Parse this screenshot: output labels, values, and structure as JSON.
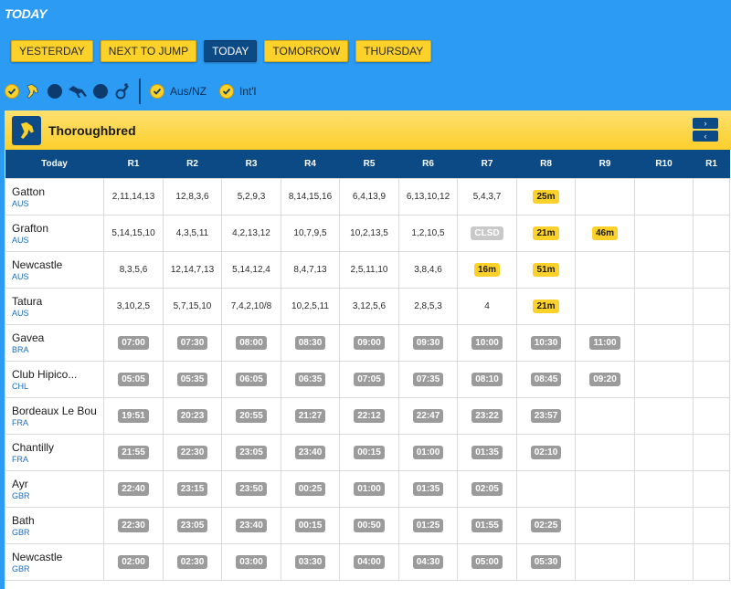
{
  "header": {
    "title": "TODAY"
  },
  "day_tabs": [
    {
      "label": "YESTERDAY",
      "active": false
    },
    {
      "label": "NEXT TO JUMP",
      "active": false
    },
    {
      "label": "TODAY",
      "active": true
    },
    {
      "label": "TOMORROW",
      "active": false
    },
    {
      "label": "THURSDAY",
      "active": false
    }
  ],
  "filters": {
    "code_icons": [
      "thoroughbred-icon",
      "harness-icon",
      "greyhound-icon"
    ],
    "regions": [
      {
        "label": "Aus/NZ",
        "checked": true
      },
      {
        "label": "Int'l",
        "checked": true
      }
    ]
  },
  "panel": {
    "title": "Thoroughbred",
    "scroll_next": "›",
    "scroll_prev": "‹"
  },
  "columns": [
    "Today",
    "R1",
    "R2",
    "R3",
    "R4",
    "R5",
    "R6",
    "R7",
    "R8",
    "R9",
    "R10",
    "R1"
  ],
  "venues": [
    {
      "name": "Gatton",
      "country": "AUS",
      "races": [
        {
          "t": "text",
          "v": "2,11,14,13"
        },
        {
          "t": "text",
          "v": "12,8,3,6"
        },
        {
          "t": "text",
          "v": "5,2,9,3"
        },
        {
          "t": "text",
          "v": "8,14,15,16"
        },
        {
          "t": "text",
          "v": "6,4,13,9"
        },
        {
          "t": "text",
          "v": "6,13,10,12"
        },
        {
          "t": "text",
          "v": "5,4,3,7"
        },
        {
          "t": "countdown",
          "v": "25m"
        },
        {
          "t": "empty",
          "v": ""
        },
        {
          "t": "empty",
          "v": ""
        },
        {
          "t": "empty",
          "v": ""
        }
      ]
    },
    {
      "name": "Grafton",
      "country": "AUS",
      "races": [
        {
          "t": "text",
          "v": "5,14,15,10"
        },
        {
          "t": "text",
          "v": "4,3,5,11"
        },
        {
          "t": "text",
          "v": "4,2,13,12"
        },
        {
          "t": "text",
          "v": "10,7,9,5"
        },
        {
          "t": "text",
          "v": "10,2,13,5"
        },
        {
          "t": "text",
          "v": "1,2,10,5"
        },
        {
          "t": "closed",
          "v": "CLSD"
        },
        {
          "t": "countdown",
          "v": "21m"
        },
        {
          "t": "countdown",
          "v": "46m"
        },
        {
          "t": "empty",
          "v": ""
        },
        {
          "t": "empty",
          "v": ""
        }
      ]
    },
    {
      "name": "Newcastle",
      "country": "AUS",
      "races": [
        {
          "t": "text",
          "v": "8,3,5,6"
        },
        {
          "t": "text",
          "v": "12,14,7,13"
        },
        {
          "t": "text",
          "v": "5,14,12,4"
        },
        {
          "t": "text",
          "v": "8,4,7,13"
        },
        {
          "t": "text",
          "v": "2,5,11,10"
        },
        {
          "t": "text",
          "v": "3,8,4,6"
        },
        {
          "t": "countdown",
          "v": "16m"
        },
        {
          "t": "countdown",
          "v": "51m"
        },
        {
          "t": "empty",
          "v": ""
        },
        {
          "t": "empty",
          "v": ""
        },
        {
          "t": "empty",
          "v": ""
        }
      ]
    },
    {
      "name": "Tatura",
      "country": "AUS",
      "races": [
        {
          "t": "text",
          "v": "3,10,2,5"
        },
        {
          "t": "text",
          "v": "5,7,15,10"
        },
        {
          "t": "text",
          "v": "7,4,2,10/8"
        },
        {
          "t": "text",
          "v": "10,2,5,11"
        },
        {
          "t": "text",
          "v": "3,12,5,6"
        },
        {
          "t": "text",
          "v": "2,8,5,3"
        },
        {
          "t": "text",
          "v": "4"
        },
        {
          "t": "countdown",
          "v": "21m"
        },
        {
          "t": "empty",
          "v": ""
        },
        {
          "t": "empty",
          "v": ""
        },
        {
          "t": "empty",
          "v": ""
        }
      ]
    },
    {
      "name": "Gavea",
      "country": "BRA",
      "races": [
        {
          "t": "time",
          "v": "07:00"
        },
        {
          "t": "time",
          "v": "07:30"
        },
        {
          "t": "time",
          "v": "08:00"
        },
        {
          "t": "time",
          "v": "08:30"
        },
        {
          "t": "time",
          "v": "09:00"
        },
        {
          "t": "time",
          "v": "09:30"
        },
        {
          "t": "time",
          "v": "10:00"
        },
        {
          "t": "time",
          "v": "10:30"
        },
        {
          "t": "time",
          "v": "11:00"
        },
        {
          "t": "empty",
          "v": ""
        },
        {
          "t": "empty",
          "v": ""
        }
      ]
    },
    {
      "name": "Club Hipico...",
      "country": "CHL",
      "races": [
        {
          "t": "time",
          "v": "05:05"
        },
        {
          "t": "time",
          "v": "05:35"
        },
        {
          "t": "time",
          "v": "06:05"
        },
        {
          "t": "time",
          "v": "06:35"
        },
        {
          "t": "time",
          "v": "07:05"
        },
        {
          "t": "time",
          "v": "07:35"
        },
        {
          "t": "time",
          "v": "08:10"
        },
        {
          "t": "time",
          "v": "08:45"
        },
        {
          "t": "time",
          "v": "09:20"
        },
        {
          "t": "empty",
          "v": ""
        },
        {
          "t": "empty",
          "v": ""
        }
      ]
    },
    {
      "name": "Bordeaux Le Bou",
      "country": "FRA",
      "races": [
        {
          "t": "time",
          "v": "19:51"
        },
        {
          "t": "time",
          "v": "20:23"
        },
        {
          "t": "time",
          "v": "20:55"
        },
        {
          "t": "time",
          "v": "21:27"
        },
        {
          "t": "time",
          "v": "22:12"
        },
        {
          "t": "time",
          "v": "22:47"
        },
        {
          "t": "time",
          "v": "23:22"
        },
        {
          "t": "time",
          "v": "23:57"
        },
        {
          "t": "empty",
          "v": ""
        },
        {
          "t": "empty",
          "v": ""
        },
        {
          "t": "empty",
          "v": ""
        }
      ]
    },
    {
      "name": "Chantilly",
      "country": "FRA",
      "races": [
        {
          "t": "time",
          "v": "21:55"
        },
        {
          "t": "time",
          "v": "22:30"
        },
        {
          "t": "time",
          "v": "23:05"
        },
        {
          "t": "time",
          "v": "23:40"
        },
        {
          "t": "time",
          "v": "00:15"
        },
        {
          "t": "time",
          "v": "01:00"
        },
        {
          "t": "time",
          "v": "01:35"
        },
        {
          "t": "time",
          "v": "02:10"
        },
        {
          "t": "empty",
          "v": ""
        },
        {
          "t": "empty",
          "v": ""
        },
        {
          "t": "empty",
          "v": ""
        }
      ]
    },
    {
      "name": "Ayr",
      "country": "GBR",
      "races": [
        {
          "t": "time",
          "v": "22:40"
        },
        {
          "t": "time",
          "v": "23:15"
        },
        {
          "t": "time",
          "v": "23:50"
        },
        {
          "t": "time",
          "v": "00:25"
        },
        {
          "t": "time",
          "v": "01:00"
        },
        {
          "t": "time",
          "v": "01:35"
        },
        {
          "t": "time",
          "v": "02:05"
        },
        {
          "t": "empty",
          "v": ""
        },
        {
          "t": "empty",
          "v": ""
        },
        {
          "t": "empty",
          "v": ""
        },
        {
          "t": "empty",
          "v": ""
        }
      ]
    },
    {
      "name": "Bath",
      "country": "GBR",
      "races": [
        {
          "t": "time",
          "v": "22:30"
        },
        {
          "t": "time",
          "v": "23:05"
        },
        {
          "t": "time",
          "v": "23:40"
        },
        {
          "t": "time",
          "v": "00:15"
        },
        {
          "t": "time",
          "v": "00:50"
        },
        {
          "t": "time",
          "v": "01:25"
        },
        {
          "t": "time",
          "v": "01:55"
        },
        {
          "t": "time",
          "v": "02:25"
        },
        {
          "t": "empty",
          "v": ""
        },
        {
          "t": "empty",
          "v": ""
        },
        {
          "t": "empty",
          "v": ""
        }
      ]
    },
    {
      "name": "Newcastle",
      "country": "GBR",
      "races": [
        {
          "t": "time",
          "v": "02:00"
        },
        {
          "t": "time",
          "v": "02:30"
        },
        {
          "t": "time",
          "v": "03:00"
        },
        {
          "t": "time",
          "v": "03:30"
        },
        {
          "t": "time",
          "v": "04:00"
        },
        {
          "t": "time",
          "v": "04:30"
        },
        {
          "t": "time",
          "v": "05:00"
        },
        {
          "t": "time",
          "v": "05:30"
        },
        {
          "t": "empty",
          "v": ""
        },
        {
          "t": "empty",
          "v": ""
        },
        {
          "t": "empty",
          "v": ""
        }
      ]
    }
  ]
}
